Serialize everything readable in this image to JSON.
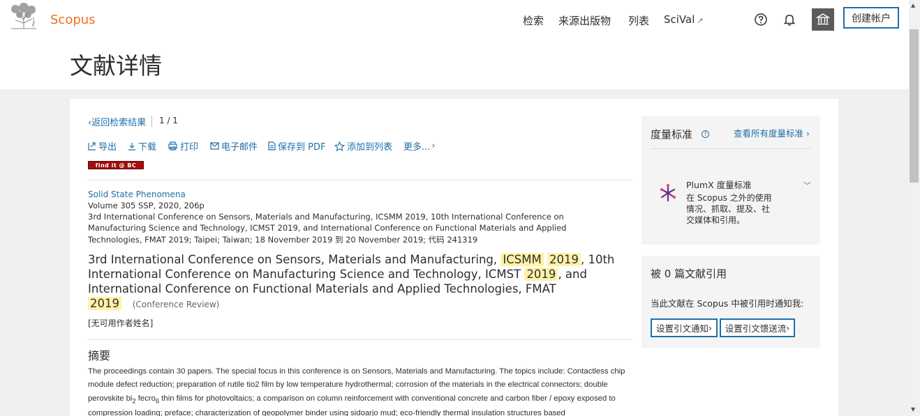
{
  "header": {
    "brand": "Scopus",
    "nav": [
      {
        "label": "检索"
      },
      {
        "label": "来源出版物"
      },
      {
        "label": "列表"
      },
      {
        "label": "SciVal",
        "arrow": "↗"
      }
    ],
    "create_account": "创建帐户",
    "page_title": "文献详情"
  },
  "toolbar": {
    "back": "返回检索结果",
    "pager": "1 / 1",
    "export": "导出",
    "download": "下载",
    "print": "打印",
    "email": "电子邮件",
    "save_pdf": "保存到 PDF",
    "add_list": "添加到列表",
    "more": "更多...",
    "findit": "find it @ BC"
  },
  "document": {
    "source": "Solid State Phenomena",
    "volume": "Volume 305 SSP, 2020, 206p",
    "conf_line1": "3rd International Conference on Sensors, Materials and Manufacturing, ICSMM 2019, 10th International Conference on",
    "conf_line2": "Manufacturing Science and Technology, ICMST 2019, and International Conference on Functional Materials and Applied",
    "conf_line3": "Technologies, FMAT 2019; Taipei; Taiwan; 18 November 2019 到 20 November 2019; 代码 241319",
    "title_p1": "3rd International Conference on Sensors, Materials and Manufacturing, ",
    "title_hl1": "ICSMM",
    "title_hl2": "2019",
    "title_p2": ", 10th International Conference on Manufacturing Science and Technology, ICMST ",
    "title_hl3": "2019",
    "title_p3": ", and International Conference on Functional Materials and Applied Technologies, FMAT ",
    "title_hl4": "2019",
    "doctype": "(Conference Review)",
    "authors": "[无可用作者姓名]",
    "abstract_heading": "摘要",
    "abstract_a": "The proceedings contain 30 papers. The special focus in this conference is on Sensors, Materials and Manufacturing. The topics include: Contactless chip module defect reduction; preparation of rutile tio2 film by low temperature hydrothermal; corrosion of the materials in the electrical connectors; double perovskite bi",
    "abstract_sub1": "2",
    "abstract_b": " fecro",
    "abstract_sub2": "6",
    "abstract_c": " thin films for photovoltaics; a comparison on column reinforcement with conventional concrete and carbon fiber / epoxy exposed to compression loading; preface; characterization of geopolymer binder using sidoarjo mud; eco-friendly thermal insulation structures based"
  },
  "sidebar": {
    "metrics_heading": "度量标准",
    "view_all": "查看所有度量标准",
    "plumx_heading": "PlumX 度量标准",
    "plumx_desc": "在 Scopus 之外的使用情况、抓取、提及、社交媒体和引用。",
    "cited_heading": "被 0 篇文献引用",
    "notify_text": "当此文献在 Scopus 中被引用时通知我:",
    "set_alert": "设置引文通知",
    "set_feed": "设置引文馈送流"
  }
}
